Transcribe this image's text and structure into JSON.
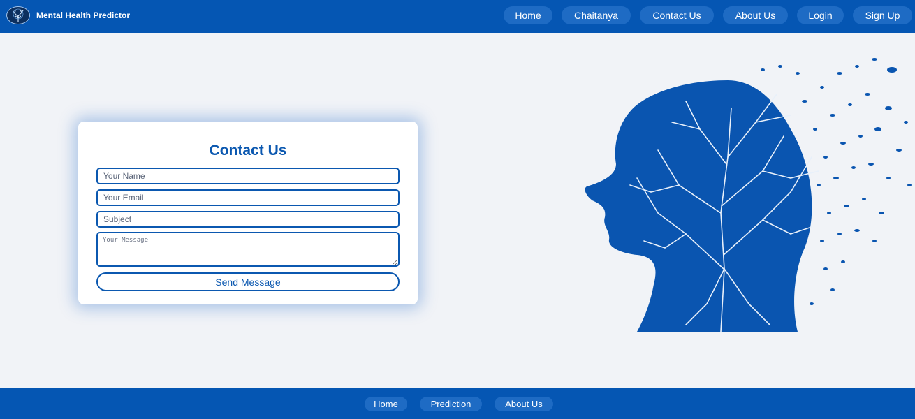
{
  "header": {
    "brand": "Mental Health Predictor",
    "logo_icon": "tree-head-icon",
    "nav": [
      {
        "label": "Home"
      },
      {
        "label": "Chaitanya"
      },
      {
        "label": "Contact Us"
      },
      {
        "label": "About Us"
      },
      {
        "label": "Login"
      },
      {
        "label": "Sign Up"
      }
    ]
  },
  "contact": {
    "title": "Contact Us",
    "name_placeholder": "Your Name",
    "email_placeholder": "Your Email",
    "subject_placeholder": "Subject",
    "message_placeholder": "Your Message",
    "send_label": "Send Message"
  },
  "hero": {
    "image_icon": "head-tree-illustration"
  },
  "footer": {
    "links": [
      {
        "label": "Home"
      },
      {
        "label": "Prediction"
      },
      {
        "label": "About Us"
      }
    ]
  },
  "colors": {
    "primary": "#0556b3",
    "pill": "#1e6bc4",
    "accent": "#0b58b0",
    "background": "#f1f3f7"
  }
}
